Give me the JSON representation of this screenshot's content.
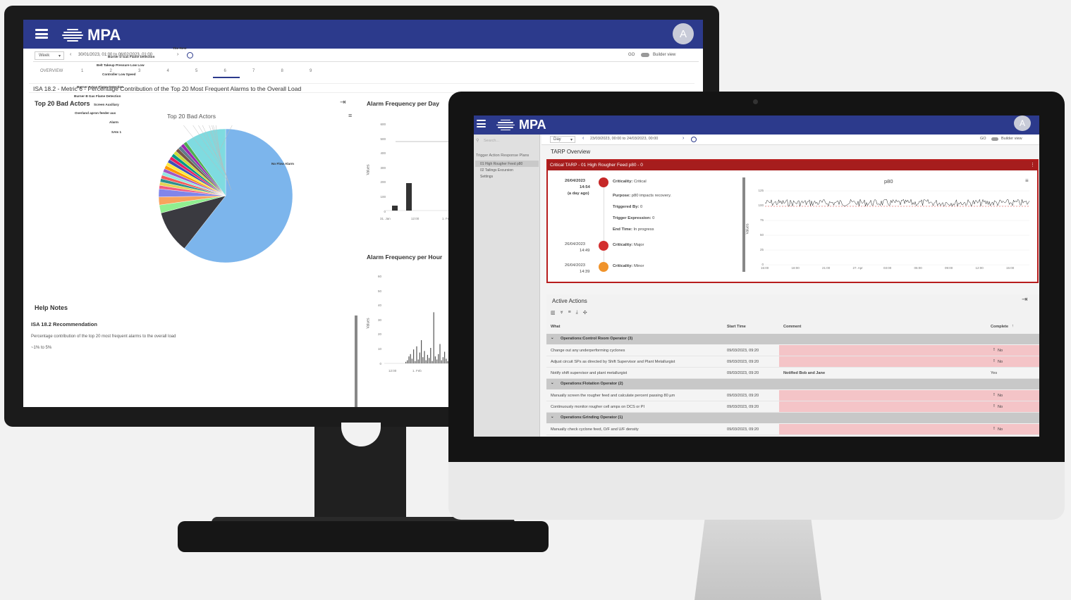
{
  "left_app": {
    "brand": "MPA",
    "avatar": "A",
    "period": "Week",
    "range": "30/01/2023, 01:00 to 06/02/2023, 01:00",
    "go": "GO",
    "builder_view": "Builder view",
    "tabs": [
      "OVERVIEW",
      "1",
      "2",
      "3",
      "4",
      "5",
      "6",
      "7",
      "8",
      "9"
    ],
    "active_tab": "6",
    "page_title": "ISA 18.2 - Metric 6 - Percentage Contribution of the Top 20 Most Frequent Alarms to the Overall Load",
    "bad_actors_title": "Top 20 Bad Actors",
    "pie_title": "Top 20 Bad Actors",
    "pie_labels": [
      "The Rest",
      "Burner D Gas Flame Detection",
      "Belt Takeup Pressure Low Low",
      "Controller Low Speed",
      "Burner A Gas Flame Detection",
      "Burner B Gas Flame Detection",
      "Screen Auxiliary",
      "Overland apron feeder aux",
      "Alarm",
      "SAIs 1",
      "No Flow Alarm"
    ],
    "freq_day_title": "Alarm Frequency per Day",
    "freq_day_yticks": [
      "600",
      "500",
      "400",
      "300",
      "200",
      "100",
      "0"
    ],
    "freq_day_xticks": [
      "31. Jan",
      "12:00",
      "1. Feb"
    ],
    "freq_hour_title": "Alarm Frequency per Hour",
    "freq_hour_yticks": [
      "60",
      "50",
      "40",
      "30",
      "20",
      "10",
      "0"
    ],
    "freq_hour_xticks": [
      "12:00",
      "1. Feb"
    ],
    "y_axis_label": "Values",
    "help_notes_title": "Help Notes",
    "recommendation_title": "ISA 18.2 Recommendation",
    "recommendation_text": "Percentage contribution of the top 20 most frequent alarms to the overall load",
    "recommendation_range": "~1% to 5%"
  },
  "right_app": {
    "brand": "MPA",
    "avatar": "A",
    "period": "Day",
    "range": "23/03/2023, 00:00 to 24/03/2023, 00:00",
    "go": "GO",
    "builder_view": "Builder view",
    "search_placeholder": "Search...",
    "sidebar": {
      "section": "Trigger Action Response Plans",
      "items": [
        "01 High Rougher Feed p80",
        "02 Tailings Excursion",
        "Settings"
      ]
    },
    "overview_title": "TARP Overview",
    "alert_banner": "Critical TARP - 01 High Rougher Feed p80 - 0",
    "events": [
      {
        "date": "26/04/2023",
        "time": "14:54",
        "ago": "(a day ago)",
        "criticality_label": "Criticality:",
        "criticality": "Critical",
        "color": "#c62828"
      },
      {
        "date": "26/04/2023",
        "time": "14:49",
        "criticality_label": "Criticality:",
        "criticality": "Major",
        "color": "#d32f2f"
      },
      {
        "date": "26/04/2023",
        "time": "14:39",
        "criticality_label": "Criticality:",
        "criticality": "Minor",
        "color": "#f0932b"
      }
    ],
    "details": {
      "purpose_label": "Purpose:",
      "purpose": "p80 impacts recovery.",
      "triggered_label": "Triggered By:",
      "triggered": "0",
      "trigger_expr_label": "Trigger Expression:",
      "trigger_expr": "0",
      "end_time_label": "End Time:",
      "end_time": "In progress"
    },
    "p80_chart": {
      "title": "p80",
      "y_label": "Values",
      "yticks": [
        "125",
        "100",
        "75",
        "50",
        "25",
        "0"
      ],
      "xticks": [
        "15:00",
        "18:00",
        "21:00",
        "27. Apr",
        "03:00",
        "06:00",
        "09:00",
        "12:00",
        "15:00"
      ]
    },
    "actions_title": "Active Actions",
    "columns": {
      "what": "What",
      "start": "Start Time",
      "comment": "Comment",
      "complete": "Complete"
    },
    "groups": [
      {
        "name": "Operations:Control Room Operator (3)",
        "rows": [
          {
            "what": "Change out any underperforming cyclones",
            "start": "09/03/2023, 09:20",
            "comment": "",
            "complete": "No",
            "pending": true
          },
          {
            "what": "Adjust circuit SPs as directed by Shift Supervisor and Plant Metallurgist",
            "start": "09/03/2023, 09:20",
            "comment": "",
            "complete": "No",
            "pending": true
          },
          {
            "what": "Notify shift supervisor and plant metallurgist",
            "start": "09/03/2023, 09:20",
            "comment": "Notified Bob and Jane",
            "complete": "Yes",
            "pending": false
          }
        ]
      },
      {
        "name": "Operations:Flotation Operator (2)",
        "rows": [
          {
            "what": "Manually screen the rougher feed and calculate percent passing 80 µm",
            "start": "09/03/2023, 09:20",
            "comment": "",
            "complete": "No",
            "pending": true
          },
          {
            "what": "Continuously monitor rougher cell amps on DCS or PI",
            "start": "09/03/2023, 09:20",
            "comment": "",
            "complete": "No",
            "pending": true
          }
        ]
      },
      {
        "name": "Operations:Grinding Operator (1)",
        "rows": [
          {
            "what": "Manually check cyclone feed, O/F and U/F density",
            "start": "09/03/2023, 09:20",
            "comment": "",
            "complete": "No",
            "pending": true
          }
        ]
      }
    ]
  }
}
